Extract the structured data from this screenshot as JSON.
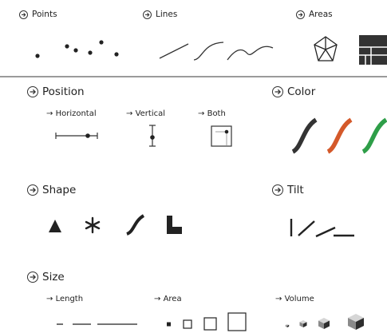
{
  "marks": {
    "points": "Points",
    "lines": "Lines",
    "areas": "Areas"
  },
  "channels": {
    "position": {
      "title": "Position",
      "horizontal": "Horizontal",
      "vertical": "Vertical",
      "both": "Both"
    },
    "color": {
      "title": "Color",
      "swatches": [
        "#333333",
        "#d4592a",
        "#2e9e48"
      ]
    },
    "shape": {
      "title": "Shape"
    },
    "tilt": {
      "title": "Tilt"
    },
    "size": {
      "title": "Size",
      "length": "Length",
      "area": "Area",
      "volume": "Volume"
    }
  },
  "glyphs": {
    "arrow": "→",
    "asterisk": "✳"
  }
}
